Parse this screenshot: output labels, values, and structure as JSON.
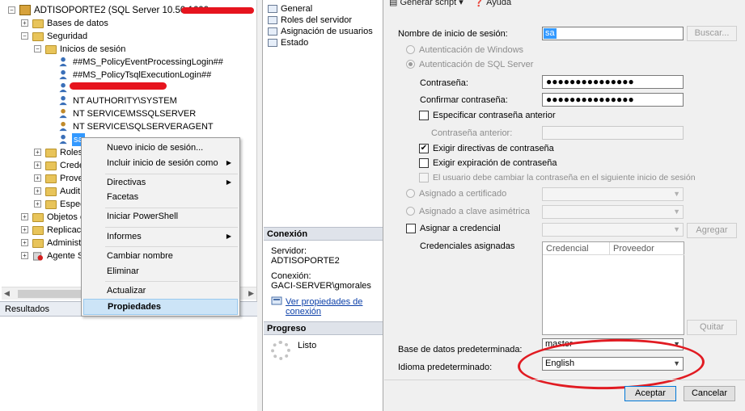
{
  "explorer": {
    "server_label": "ADTISOPORTE2 (SQL Server 10.50.1600",
    "nodes": {
      "bases_datos": "Bases de datos",
      "seguridad": "Seguridad",
      "inicios_sesion": "Inicios de sesión",
      "login1": "##MS_PolicyEventProcessingLogin##",
      "login2": "##MS_PolicyTsqlExecutionLogin##",
      "login4": "NT AUTHORITY\\SYSTEM",
      "login5": "NT SERVICE\\MSSQLSERVER",
      "login6": "NT SERVICE\\SQLSERVERAGENT",
      "login7": "sa",
      "roles": "Roles",
      "credenciales": "Crede",
      "proveedores": "Prove",
      "auditorias": "Audit",
      "especificaciones": "Espec",
      "objetos": "Objetos c",
      "replicacion": "Replicació",
      "administracion": "Administ",
      "agente": "Agente S("
    }
  },
  "results_bar": {
    "label": "Resultados"
  },
  "context_menu": {
    "items": [
      "Nuevo inicio de sesión...",
      "Incluir inicio de sesión como",
      "Directivas",
      "Facetas",
      "Iniciar PowerShell",
      "Informes",
      "Cambiar nombre",
      "Eliminar",
      "Actualizar",
      "Propiedades"
    ]
  },
  "pages": {
    "items": [
      "General",
      "Roles del servidor",
      "Asignación de usuarios",
      "Estado"
    ],
    "conexion_header": "Conexión",
    "servidor_label": "Servidor:",
    "servidor_value": "ADTISOPORTE2",
    "conexion_label": "Conexión:",
    "conexion_value": "GACI-SERVER\\gmorales",
    "ver_link_1": "Ver propiedades de",
    "ver_link_2": "conexión",
    "progreso_header": "Progreso",
    "progreso_status": "Listo"
  },
  "props": {
    "toolbar": {
      "script": "Generar script",
      "help": "Ayuda"
    },
    "login_name_label": "Nombre de inicio de sesión:",
    "login_name_value": "sa",
    "buscar_button": "Buscar...",
    "auth_windows": "Autenticación de Windows",
    "auth_sql": "Autenticación de SQL Server",
    "password_label": "Contraseña:",
    "password_value": "●●●●●●●●●●●●●●●",
    "confirm_label": "Confirmar contraseña:",
    "confirm_value": "●●●●●●●●●●●●●●●",
    "specify_old": "Especificar contraseña anterior",
    "old_password_label": "Contraseña anterior:",
    "enforce_policy": "Exigir directivas de contraseña",
    "enforce_expiration": "Exigir expiración de contraseña",
    "must_change": "El usuario debe cambiar la contraseña en el siguiente inicio de sesión",
    "mapped_cert": "Asignado a certificado",
    "mapped_asym": "Asignado a clave asimétrica",
    "map_credential": "Asignar a credencial",
    "agregar_button": "Agregar",
    "mapped_credentials_label": "Credenciales asignadas",
    "grid_col_credential": "Credencial",
    "grid_col_provider": "Proveedor",
    "quitar_button": "Quitar",
    "default_db_label": "Base de datos predeterminada:",
    "default_db_value": "master",
    "default_lang_label": "Idioma predeterminado:",
    "default_lang_value": "English",
    "aceptar_button": "Aceptar",
    "cancelar_button": "Cancelar"
  },
  "colors": {
    "annotation_red": "#e11b22",
    "selection_blue": "#3399ff",
    "menu_highlight": "#cce4f7"
  }
}
